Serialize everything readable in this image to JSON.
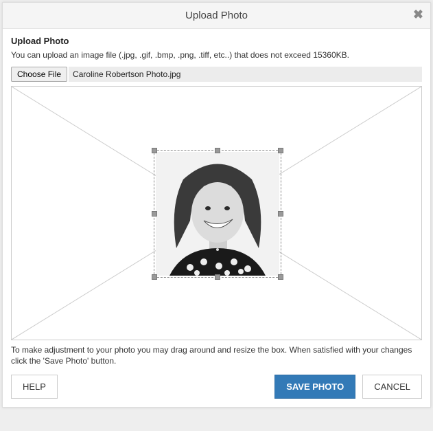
{
  "modal": {
    "title": "Upload Photo",
    "close_glyph": "✖"
  },
  "body": {
    "section_title": "Upload Photo",
    "hint": "You can upload an image file (.jpg, .gif, .bmp, .png, .tiff, etc..) that does not exceed 15360KB.",
    "choose_label": "Choose File",
    "filename": "Caroline Robertson Photo.jpg",
    "instructions": "To make adjustment to your photo you may drag around and resize the box. When satisfied with your changes click the 'Save Photo' button."
  },
  "buttons": {
    "help": "HELP",
    "save": "SAVE PHOTO",
    "cancel": "CANCEL"
  }
}
